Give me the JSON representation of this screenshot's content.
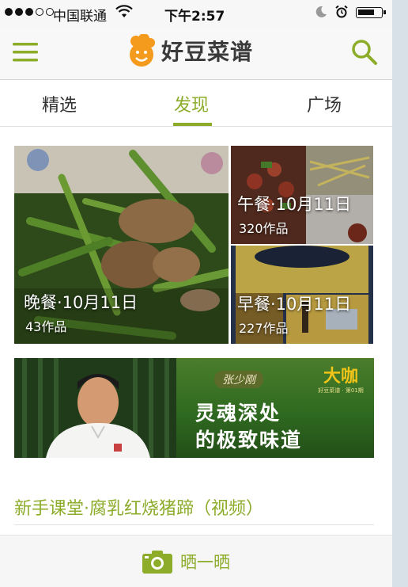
{
  "status_bar": {
    "carrier": "中国联通",
    "time": "下午2:57"
  },
  "header": {
    "app_name": "好豆菜谱",
    "menu_icon": "hamburger-menu-icon",
    "search_icon": "search-icon",
    "accent_color": "#8cac2a"
  },
  "tabs": [
    {
      "label": "精选",
      "active": false
    },
    {
      "label": "发现",
      "active": true
    },
    {
      "label": "广场",
      "active": false
    }
  ],
  "feed_cards": [
    {
      "title": "晚餐·10月11日",
      "count": "43作品"
    },
    {
      "title": "午餐·10月11日",
      "count": "320作品"
    },
    {
      "title": "早餐·10月11日",
      "count": "227作品"
    }
  ],
  "banner": {
    "chef_name": "张少刚",
    "slogan_line1": "灵魂深处",
    "slogan_line2": "的极致味道",
    "brand": "大咖",
    "brand_sub": "好豆菜谱 · 第01期"
  },
  "article": {
    "title": "新手课堂·腐乳红烧猪蹄（视频）"
  },
  "bottom_bar": {
    "share_label": "晒一晒",
    "camera_icon": "camera-icon"
  }
}
